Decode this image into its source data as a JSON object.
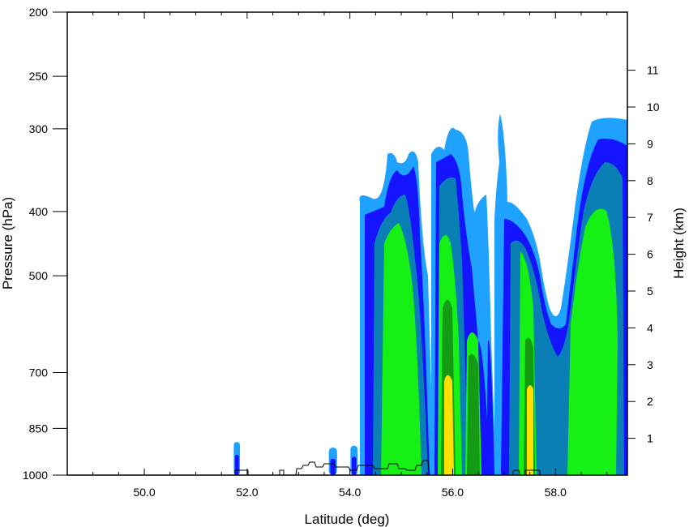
{
  "chart_data": {
    "type": "filled-contour cross-section",
    "xlabel": "Latitude (deg)",
    "ylabel": "Pressure (hPa)",
    "y2label": "Height (km)",
    "x_ticks": [
      {
        "value": 50.0,
        "label": "50.0"
      },
      {
        "value": 52.0,
        "label": "52.0"
      },
      {
        "value": 54.0,
        "label": "54.0"
      },
      {
        "value": 56.0,
        "label": "56.0"
      },
      {
        "value": 58.0,
        "label": "58.0"
      }
    ],
    "xlim": [
      48.5,
      59.4
    ],
    "ylim": [
      1000,
      200
    ],
    "y_scale": "log",
    "y_ticks": [
      {
        "value": 200,
        "label": "200"
      },
      {
        "value": 250,
        "label": "250"
      },
      {
        "value": 300,
        "label": "300"
      },
      {
        "value": 400,
        "label": "400"
      },
      {
        "value": 500,
        "label": "500"
      },
      {
        "value": 700,
        "label": "700"
      },
      {
        "value": 850,
        "label": "850"
      },
      {
        "value": 1000,
        "label": "1000"
      }
    ],
    "y2_ticks": [
      {
        "value": 1,
        "label": "1"
      },
      {
        "value": 2,
        "label": "2"
      },
      {
        "value": 3,
        "label": "3"
      },
      {
        "value": 4,
        "label": "4"
      },
      {
        "value": 5,
        "label": "5"
      },
      {
        "value": 6,
        "label": "6"
      },
      {
        "value": 7,
        "label": "7"
      },
      {
        "value": 8,
        "label": "8"
      },
      {
        "value": 9,
        "label": "9"
      },
      {
        "value": 10,
        "label": "10"
      },
      {
        "value": 11,
        "label": "11"
      }
    ],
    "fill_levels": [
      {
        "level": 1,
        "color": "#1fa2ff"
      },
      {
        "level": 2,
        "color": "#1414ff"
      },
      {
        "level": 3,
        "color": "#0a7fb5"
      },
      {
        "level": 4,
        "color": "#15f015"
      },
      {
        "level": 5,
        "color": "#149a14"
      },
      {
        "level": 6,
        "color": "#ffe000"
      }
    ],
    "grid": false,
    "legend": "none"
  }
}
